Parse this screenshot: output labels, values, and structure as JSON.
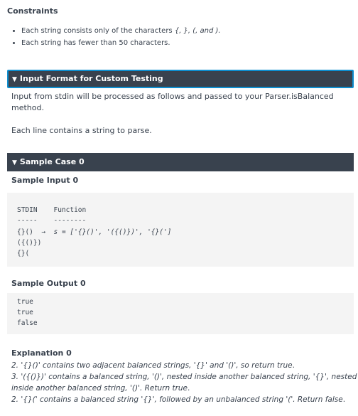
{
  "constraints": {
    "heading": "Constraints",
    "items": [
      {
        "pre": "Each string consists only of the characters ",
        "chars": "{, }, (, and ).",
        "post": ""
      },
      {
        "pre": "Each string has fewer than 50 characters.",
        "chars": "",
        "post": ""
      }
    ]
  },
  "input_format": {
    "title": "Input Format for Custom Testing",
    "line1": "Input from stdin will be processed as follows and passed to your Parser.isBalanced",
    "line2": "method.",
    "line3": "Each line contains a string to parse."
  },
  "sample_case": {
    "title": "Sample Case 0",
    "input_heading": "Sample Input 0",
    "input_header": "STDIN    Function",
    "input_divider": "-----    --------",
    "input_row1_val": "{}()",
    "input_row1_arrow": "→",
    "input_row1_func": "s = ['{}()', '({()})', '{}(']",
    "input_row2": "({()})",
    "input_row3": "{}(",
    "output_heading": "Sample Output 0",
    "output_lines": [
      "true",
      "true",
      "false"
    ],
    "explanation_heading": "Explanation 0",
    "explanation": [
      {
        "num": "2.",
        "text": "'{}()' contains two adjacent balanced strings, '{}' and '()', so return ",
        "em": "true",
        "end": "."
      },
      {
        "num": "3.",
        "text": "'({()})' contains a balanced string, '()', nested inside another balanced string, '{}', nested",
        "em": "",
        "end": ""
      },
      {
        "num": "",
        "text": "inside another balanced string, '()'. Return ",
        "em": "true",
        "end": "."
      },
      {
        "num": "2.",
        "text": "'{}(' contains a balanced string '{}', followed by an unbalanced string '('. Return ",
        "em": "false",
        "end": "."
      }
    ]
  }
}
